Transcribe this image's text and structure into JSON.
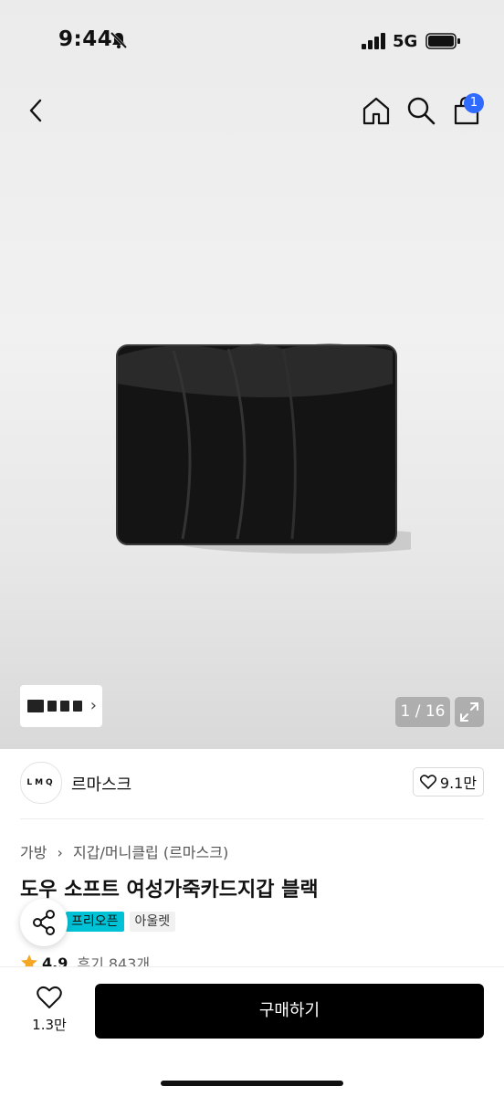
{
  "status_bar": {
    "time": "9:44",
    "network": "5G"
  },
  "nav": {
    "cart_count": "1"
  },
  "gallery": {
    "counter": "1 / 16"
  },
  "brand": {
    "logo_text": "LMQ",
    "name": "르마스크",
    "likes": "9.1만"
  },
  "breadcrumb": {
    "level1": "가방",
    "level2": "지갑/머니클립 (르마스크)"
  },
  "product": {
    "title": "도우 소프트 여성가죽카드지갑 블랙",
    "tags": {
      "preopen": "프리오픈",
      "outlet": "아울렛"
    },
    "rating": "4.9",
    "reviews": "후기 843개"
  },
  "bottom_bar": {
    "wish_count": "1.3만",
    "buy_label": "구매하기"
  },
  "colors": {
    "accent_blue": "#2f6bff",
    "tag_cyan": "#00c2d6",
    "buy_button": "#000000",
    "star": "#f5a623"
  }
}
